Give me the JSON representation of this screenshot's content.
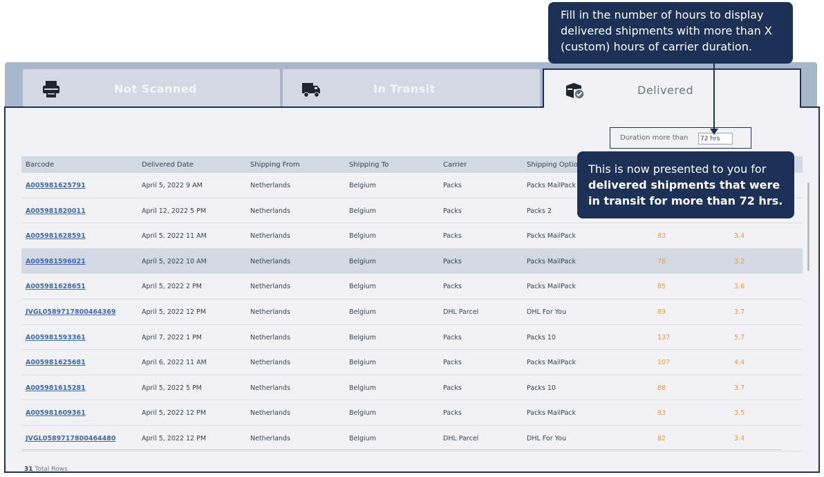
{
  "tabs": [
    {
      "label": "Not Scanned",
      "icon": "printer-icon"
    },
    {
      "label": "In Transit",
      "icon": "truck-icon"
    },
    {
      "label": "Delivered",
      "icon": "package-check-icon"
    }
  ],
  "filter": {
    "label": "Duration more than",
    "value": "72 hrs"
  },
  "table": {
    "headers": [
      "Barcode",
      "Delivered Date",
      "Shipping From",
      "Shipping To",
      "Carrier",
      "Shipping Option"
    ],
    "rows": [
      [
        "A005981625791",
        "April 5, 2022 9 AM",
        "Netherlands",
        "Belgium",
        "Packs",
        "Packs MailPack",
        "",
        ""
      ],
      [
        "A005981820011",
        "April 12, 2022 5 PM",
        "Netherlands",
        "Belgium",
        "Packs",
        "Packs 2",
        "",
        ""
      ],
      [
        "A005981628591",
        "April 5, 2022 11 AM",
        "Netherlands",
        "Belgium",
        "Packs",
        "Packs MailPack",
        "83",
        "3.4"
      ],
      [
        "A005981596021",
        "April 5, 2022 10 AM",
        "Netherlands",
        "Belgium",
        "Packs",
        "Packs MailPack",
        "78",
        "3.2"
      ],
      [
        "A005981628651",
        "April 5, 2022 2 PM",
        "Netherlands",
        "Belgium",
        "Packs",
        "Packs MailPack",
        "85",
        "3.6"
      ],
      [
        "JVGL0589717800464369",
        "April 5, 2022 12 PM",
        "Netherlands",
        "Belgium",
        "DHL Parcel",
        "DHL For You",
        "89",
        "3.7"
      ],
      [
        "A005981593361",
        "April 7, 2022 1 PM",
        "Netherlands",
        "Belgium",
        "Packs",
        "Packs 10",
        "137",
        "5.7"
      ],
      [
        "A005981625681",
        "April 6, 2022 11 AM",
        "Netherlands",
        "Belgium",
        "Packs",
        "Packs MailPack",
        "107",
        "4.4"
      ],
      [
        "A005981615281",
        "April 5, 2022 5 PM",
        "Netherlands",
        "Belgium",
        "Packs",
        "Packs 10",
        "88",
        "3.7"
      ],
      [
        "A005981609361",
        "April 5, 2022 12 PM",
        "Netherlands",
        "Belgium",
        "Packs",
        "Packs MailPack",
        "83",
        "3.5"
      ],
      [
        "JVGL0589717800464480",
        "April 5, 2022 12 PM",
        "Netherlands",
        "Belgium",
        "DHL Parcel",
        "DHL For You",
        "82",
        "3.4"
      ]
    ],
    "highlighted_row": 3
  },
  "footer": {
    "count": "31",
    "label": "Total Rows"
  },
  "callouts": {
    "top": "Fill in the number of hours to display delivered shipments with more than X (custom) hours of carrier duration.",
    "bottom_plain": "This is now presented to you for ",
    "bottom_bold": "delivered shipments that were in transit for more than 72 hrs."
  },
  "colors": {
    "navy": "#1d3156",
    "link": "#3f6aa8",
    "orange": "#f0983a",
    "tab_inactive": "#d2d9e3"
  }
}
